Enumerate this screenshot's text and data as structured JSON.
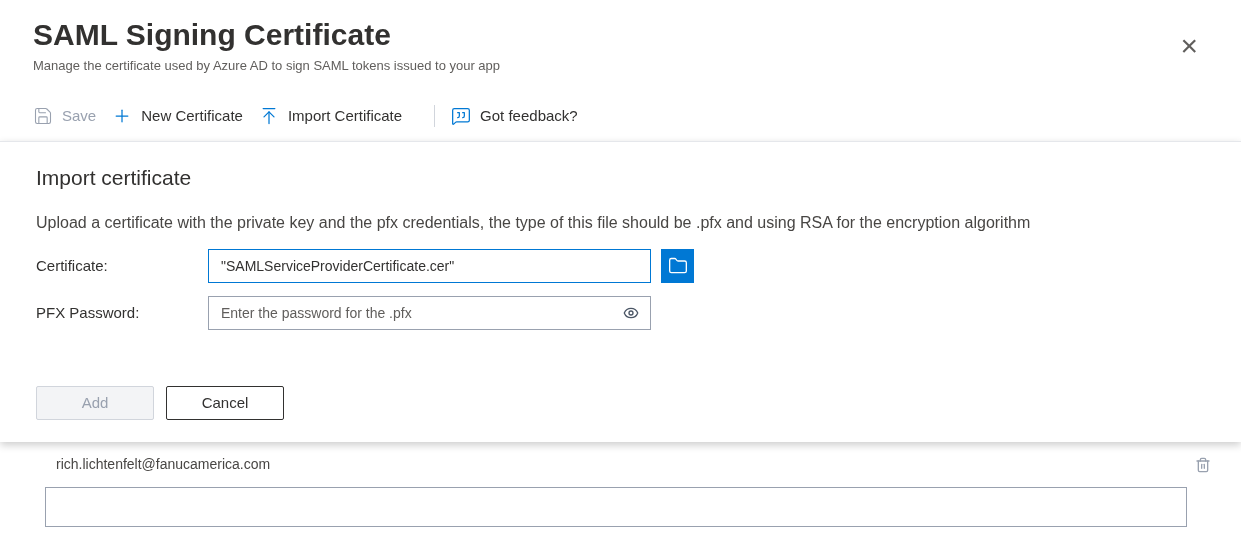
{
  "header": {
    "title": "SAML Signing Certificate",
    "subtitle": "Manage the certificate used by Azure AD to sign SAML tokens issued to your app",
    "close": "×"
  },
  "toolbar": [
    {
      "kind": "save",
      "label": "Save",
      "disabled": true
    },
    {
      "kind": "new",
      "label": "New Certificate",
      "disabled": false
    },
    {
      "kind": "import",
      "label": "Import Certificate",
      "disabled": false
    },
    {
      "kind": "feedback",
      "label": "Got feedback?",
      "disabled": false
    }
  ],
  "import_panel": {
    "title": "Import certificate",
    "description": "Upload a certificate with the private key and the pfx credentials, the type of this file should be .pfx and using RSA for the encryption algorithm",
    "certificate": {
      "label": "Certificate:",
      "value": "\"SAMLServiceProviderCertificate.cer\""
    },
    "password": {
      "label": "PFX Password:",
      "placeholder": "Enter the password for the .pfx"
    },
    "buttons": [
      {
        "label": "Add",
        "disabled": true
      },
      {
        "label": "Cancel",
        "disabled": false
      }
    ]
  },
  "notification_email": {
    "value": "rich.lichtenfelt@fanucamerica.com"
  }
}
